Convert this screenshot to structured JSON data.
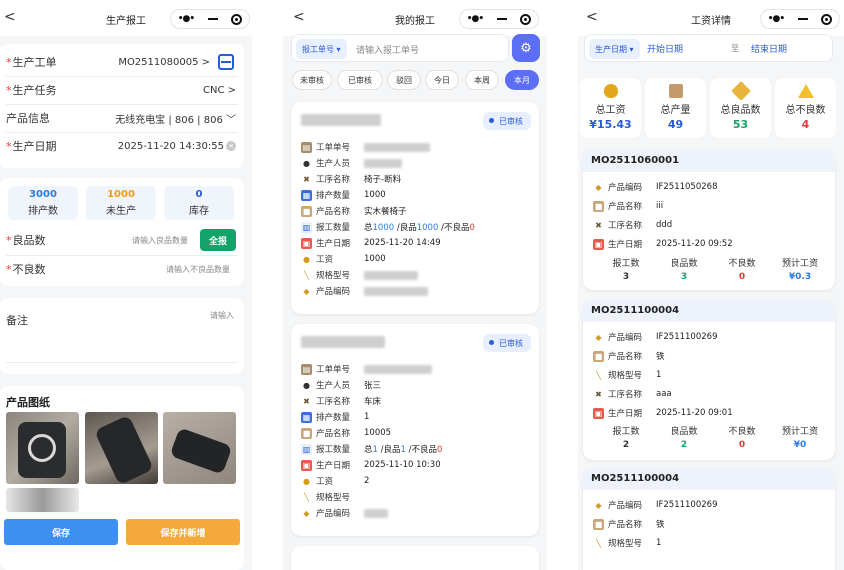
{
  "s1": {
    "title": "生产报工",
    "fields": [
      {
        "label": "生产工单",
        "required": true,
        "value": "MO2511080005 >"
      },
      {
        "label": "生产任务",
        "required": true,
        "value": "CNC >"
      },
      {
        "label": "产品信息",
        "required": false,
        "value": "无线充电宝 | 806 | 806 ﹀"
      },
      {
        "label": "生产日期",
        "required": true,
        "value": "2025-11-20 14:30:55"
      }
    ],
    "stats": [
      {
        "num": "3000",
        "label": "排产数",
        "color": "#2a7de1"
      },
      {
        "num": "1000",
        "label": "未生产",
        "color": "#f39c12"
      },
      {
        "num": "0",
        "label": "库存",
        "color": "#2a5bd7"
      }
    ],
    "good_label": "良品数",
    "good_placeholder": "请输入良品数量",
    "all_btn": "全报",
    "bad_label": "不良数",
    "bad_placeholder": "请输入不良品数量",
    "remark_label": "备注",
    "remark_placeholder": "请输入",
    "drawings_title": "产品图纸",
    "save": "保存",
    "save_new": "保存并新增"
  },
  "s2": {
    "title": "我的报工",
    "select": "报工单号 ▾",
    "search_placeholder": "请输入报工单号",
    "chips": [
      "未审核",
      "已审核",
      "驳回",
      "今日",
      "本周",
      "本月"
    ],
    "cards": [
      {
        "status": "已审核",
        "rows": [
          {
            "k": "工单单号",
            "v": ""
          },
          {
            "k": "生产人员",
            "v": ""
          },
          {
            "k": "工序名称",
            "v": "椅子-断料"
          },
          {
            "k": "排产数量",
            "v": "1000"
          },
          {
            "k": "产品名称",
            "v": "实木餐椅子"
          },
          {
            "k": "报工数量",
            "total_pre": "总",
            "total": "1000",
            "good_pre": " /良品",
            "good": "1000",
            "bad_pre": " /不良品",
            "bad": "0"
          },
          {
            "k": "生产日期",
            "v": "2025-11-20 14:49"
          },
          {
            "k": "工资",
            "v": "1000"
          },
          {
            "k": "规格型号",
            "v": ""
          },
          {
            "k": "产品编码",
            "v": ""
          }
        ]
      },
      {
        "status": "已审核",
        "rows": [
          {
            "k": "工单单号",
            "v": ""
          },
          {
            "k": "生产人员",
            "v": "张三"
          },
          {
            "k": "工序名称",
            "v": "车床"
          },
          {
            "k": "排产数量",
            "v": "1"
          },
          {
            "k": "产品名称",
            "v": "10005"
          },
          {
            "k": "报工数量",
            "total_pre": "总",
            "total": "1",
            "good_pre": " /良品",
            "good": "1",
            "bad_pre": " /不良品",
            "bad": "0"
          },
          {
            "k": "生产日期",
            "v": "2025-11-10 10:30"
          },
          {
            "k": "工资",
            "v": "2"
          },
          {
            "k": "规格型号",
            "v": ""
          },
          {
            "k": "产品编码",
            "v": ""
          }
        ]
      }
    ]
  },
  "s3": {
    "title": "工资详情",
    "select": "生产日期 ▾",
    "start": "开始日期",
    "sep": "至",
    "end": "结束日期",
    "summary": [
      {
        "label": "总工资",
        "value": "¥15.43",
        "color": "#2a5bd7",
        "icon": "money-bag-icon"
      },
      {
        "label": "总产量",
        "value": "49",
        "color": "#2a5bd7",
        "icon": "box-icon"
      },
      {
        "label": "总良品数",
        "value": "53",
        "color": "#12a36b",
        "icon": "tag-icon"
      },
      {
        "label": "总不良数",
        "value": "4",
        "color": "#e53935",
        "icon": "warning-icon"
      }
    ],
    "stat_labels": [
      "报工数",
      "良品数",
      "不良数",
      "预计工资"
    ],
    "records": [
      {
        "order": "MO2511060001",
        "rows": [
          {
            "k": "产品编码",
            "v": "IF2511050268"
          },
          {
            "k": "产品名称",
            "v": "iii"
          },
          {
            "k": "工序名称",
            "v": "ddd"
          },
          {
            "k": "生产日期",
            "v": "2025-11-20 09:52"
          }
        ],
        "stats": [
          "3",
          "3",
          "0",
          "¥0.3"
        ]
      },
      {
        "order": "MO2511100004",
        "rows": [
          {
            "k": "产品编码",
            "v": "IF2511100269"
          },
          {
            "k": "产品名称",
            "v": "铁"
          },
          {
            "k": "规格型号",
            "v": "1"
          },
          {
            "k": "工序名称",
            "v": "aaa"
          },
          {
            "k": "生产日期",
            "v": "2025-11-20 09:01"
          }
        ],
        "stats": [
          "2",
          "2",
          "0",
          "¥0"
        ]
      },
      {
        "order": "MO2511100004",
        "rows": [
          {
            "k": "产品编码",
            "v": "IF2511100269"
          },
          {
            "k": "产品名称",
            "v": "铁"
          },
          {
            "k": "规格型号",
            "v": "1"
          }
        ],
        "stats": []
      }
    ]
  }
}
